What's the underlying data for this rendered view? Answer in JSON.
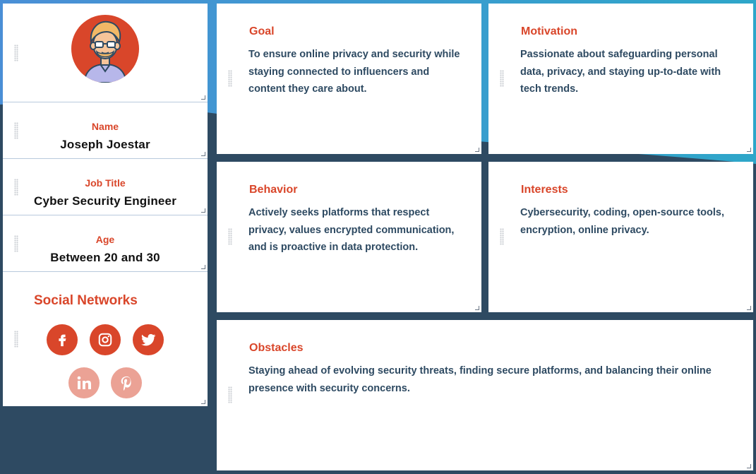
{
  "colors": {
    "accent": "#d9462a",
    "accent_faded": "#eba295",
    "text_dark": "#2e4a62",
    "background_dark": "#2e4a62",
    "background_blue_left": "#4a8fd6",
    "background_blue_right": "#2ea6c9"
  },
  "profile": {
    "avatar_icon": "person-with-glasses-avatar",
    "name_label": "Name",
    "name_value": "Joseph Joestar",
    "job_label": "Job Title",
    "job_value": "Cyber Security Engineer",
    "age_label": "Age",
    "age_value": "Between 20 and 30"
  },
  "social": {
    "title": "Social Networks",
    "networks": [
      {
        "name": "facebook",
        "icon": "facebook-icon",
        "active": true
      },
      {
        "name": "instagram",
        "icon": "instagram-icon",
        "active": true
      },
      {
        "name": "twitter",
        "icon": "twitter-icon",
        "active": true
      },
      {
        "name": "linkedin",
        "icon": "linkedin-icon",
        "active": false
      },
      {
        "name": "pinterest",
        "icon": "pinterest-icon",
        "active": false
      }
    ]
  },
  "cards": {
    "goal": {
      "title": "Goal",
      "text": "To ensure online privacy and security while staying connected to influencers and content they care about."
    },
    "motivation": {
      "title": "Motivation",
      "text": "Passionate about safeguarding personal data, privacy, and staying up-to-date with tech trends."
    },
    "behavior": {
      "title": "Behavior",
      "text": "Actively seeks platforms that respect privacy, values encrypted communication, and is proactive in data protection."
    },
    "interests": {
      "title": "Interests",
      "text": "Cybersecurity, coding, open-source tools, encryption, online privacy."
    },
    "obstacles": {
      "title": "Obstacles",
      "text": "Staying ahead of evolving security threats, finding secure platforms, and balancing their online presence with security concerns."
    }
  }
}
